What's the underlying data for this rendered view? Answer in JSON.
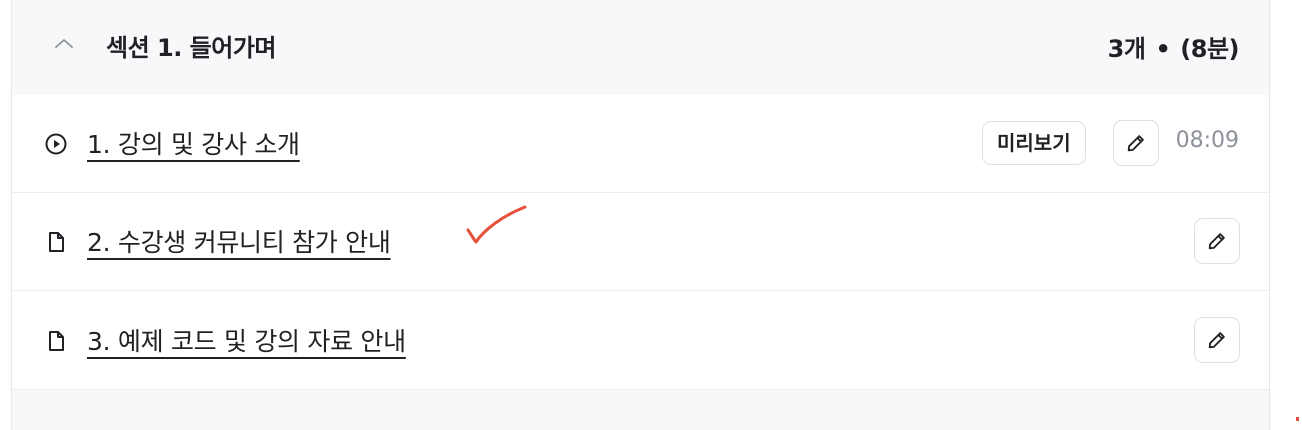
{
  "section": {
    "title": "섹션 1. 들어가며",
    "count": "3개",
    "separator": "•",
    "duration": "(8분)",
    "chevron_icon": "chevron-up-icon"
  },
  "lectures": [
    {
      "title": "1. 강의 및 강사 소개",
      "type_icon": "play-circle-icon",
      "preview_label": "미리보기",
      "edit_icon": "pencil-icon",
      "duration": "08:09"
    },
    {
      "title": "2. 수강생 커뮤니티 참가 안내",
      "type_icon": "document-icon",
      "edit_icon": "pencil-icon"
    },
    {
      "title": "3. 예제 코드 및 강의 자료 안내",
      "type_icon": "document-icon",
      "edit_icon": "pencil-icon"
    }
  ],
  "colors": {
    "header_bg": "#f7f8fa",
    "text": "#1f2124",
    "muted": "#8c9199",
    "annotation_red": "#e5503a"
  }
}
